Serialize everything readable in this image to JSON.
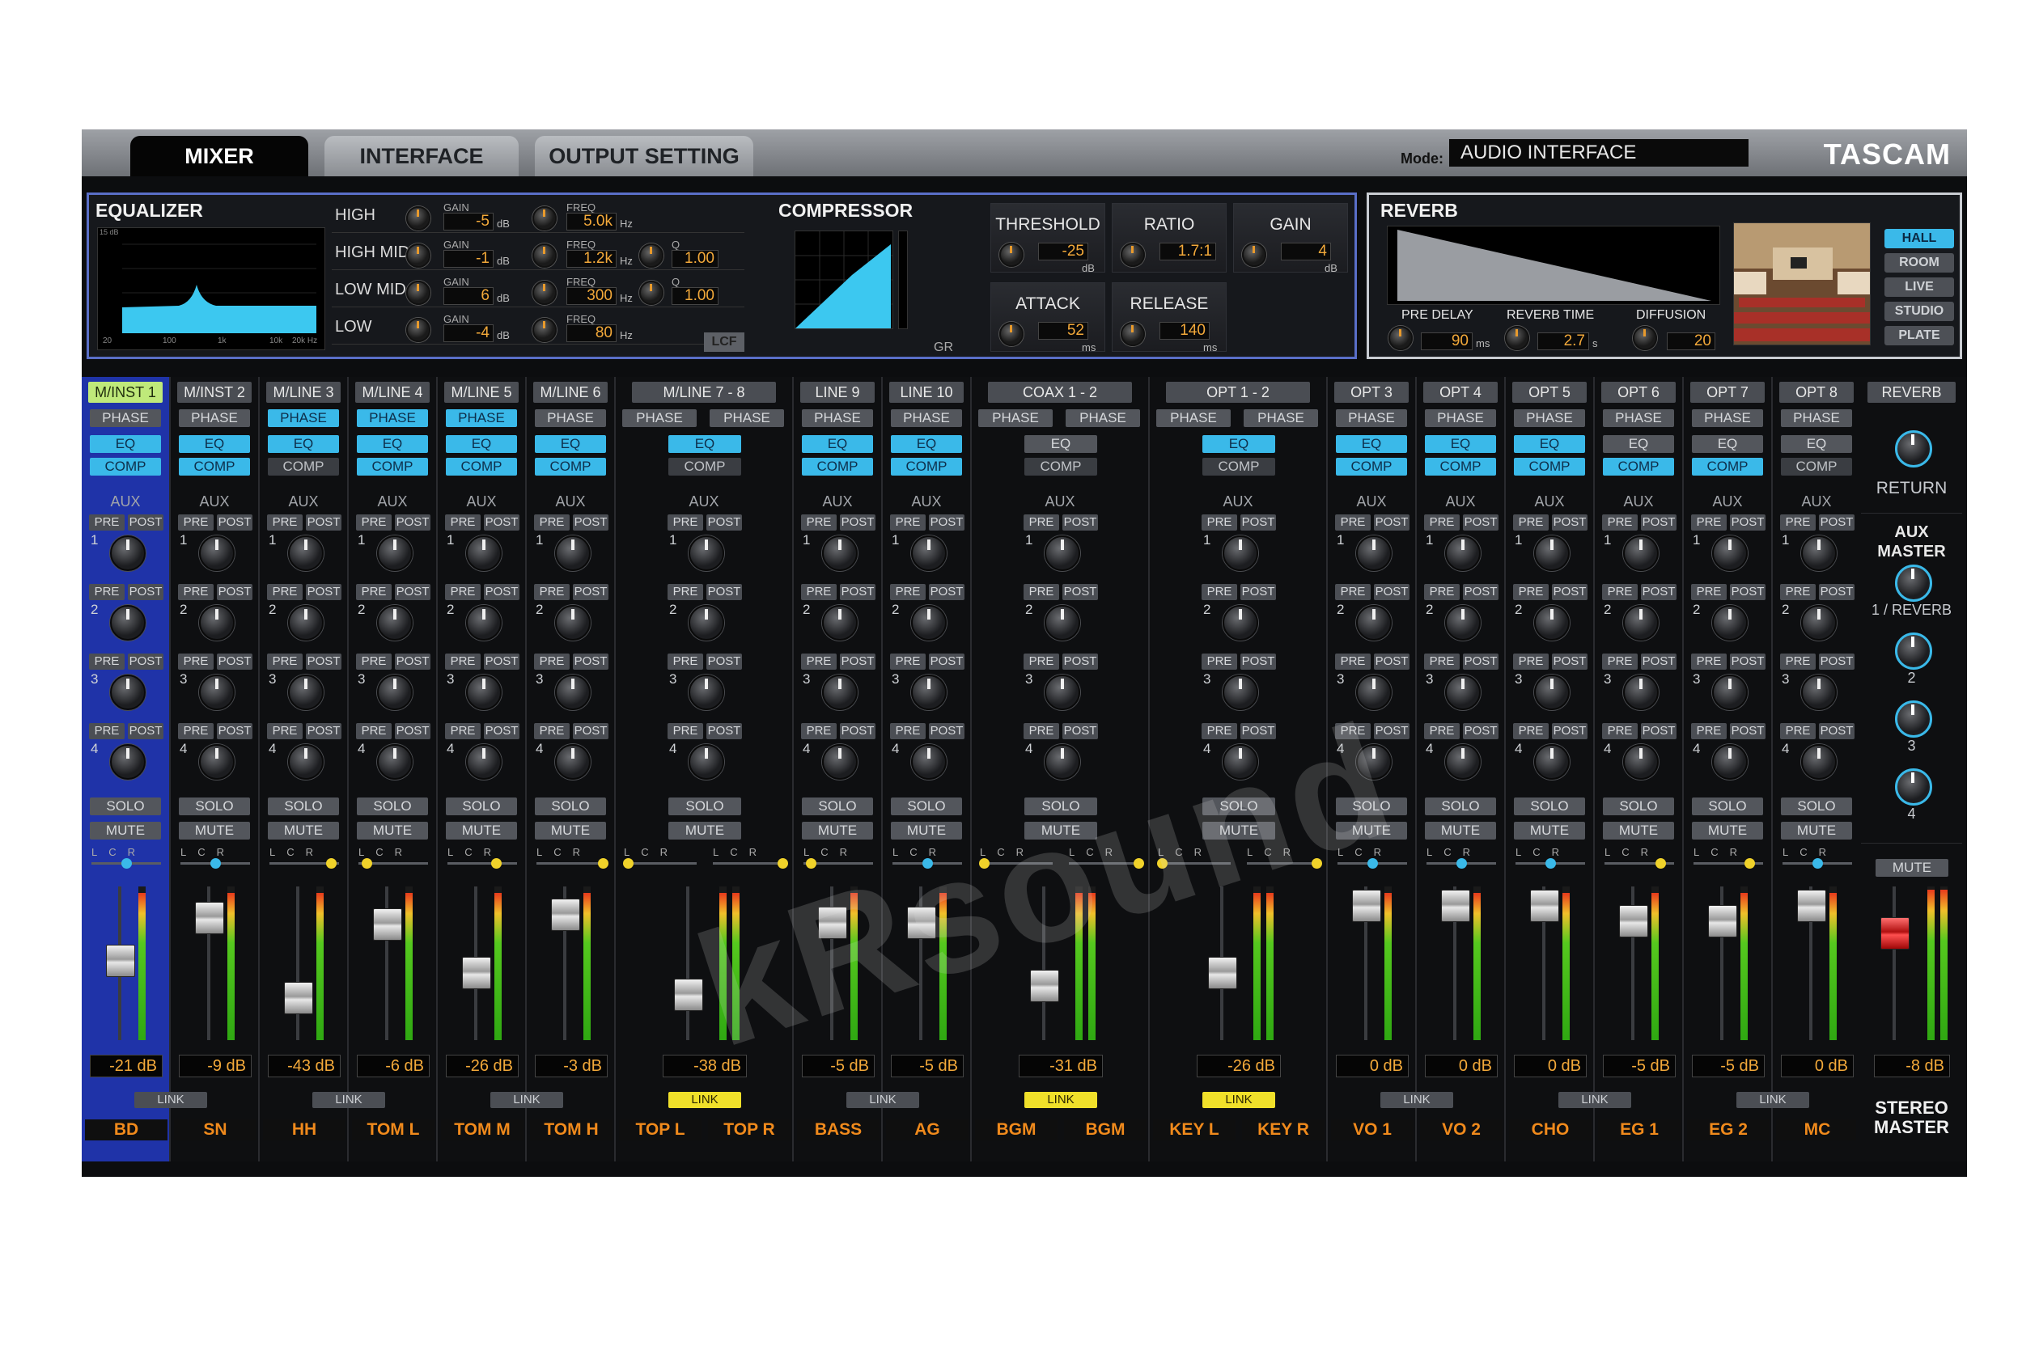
{
  "tabs": [
    {
      "label": "MIXER",
      "active": true
    },
    {
      "label": "INTERFACE",
      "active": false
    },
    {
      "label": "OUTPUT SETTING",
      "active": false
    }
  ],
  "mode": {
    "label": "Mode:",
    "value": "AUDIO INTERFACE"
  },
  "brand": "TASCAM",
  "equalizer": {
    "title": "EQUALIZER",
    "axis_y": [
      "15 dB",
      "10",
      "5",
      "0",
      "-5",
      "-10",
      "-15"
    ],
    "axis_x": [
      "20",
      "100",
      "1k",
      "10k",
      "20k Hz"
    ],
    "gain_label": "GAIN",
    "freq_label": "FREQ",
    "q_label": "Q",
    "db_unit": "dB",
    "hz_unit": "Hz",
    "bands": [
      {
        "name": "HIGH",
        "gain": "-5",
        "freq": "5.0k",
        "q": ""
      },
      {
        "name": "HIGH MID",
        "gain": "-1",
        "freq": "1.2k",
        "q": "1.00"
      },
      {
        "name": "LOW MID",
        "gain": "6",
        "freq": "300",
        "q": "1.00"
      },
      {
        "name": "LOW",
        "gain": "-4",
        "freq": "80",
        "q": ""
      }
    ],
    "lcf_label": "LCF"
  },
  "compressor": {
    "title": "COMPRESSOR",
    "axis_y": [
      "0",
      "-12",
      "-24",
      "-36",
      "-48"
    ],
    "axis_x": [
      "-48",
      "-36",
      "-24",
      "-12",
      "dB"
    ],
    "gr_label": "GR",
    "threshold": {
      "label": "THRESHOLD",
      "value": "-25",
      "unit": "dB"
    },
    "ratio": {
      "label": "RATIO",
      "value": "1.7:1"
    },
    "gain": {
      "label": "GAIN",
      "value": "4",
      "unit": "dB"
    },
    "attack": {
      "label": "ATTACK",
      "value": "52",
      "unit": "ms"
    },
    "release": {
      "label": "RELEASE",
      "value": "140",
      "unit": "ms"
    }
  },
  "reverb": {
    "title": "REVERB",
    "pre_delay": {
      "label": "PRE DELAY",
      "value": "90",
      "unit": "ms"
    },
    "reverb_time": {
      "label": "REVERB TIME",
      "value": "2.7",
      "unit": "s"
    },
    "diffusion": {
      "label": "DIFFUSION",
      "value": "20"
    },
    "types": [
      {
        "label": "HALL",
        "active": true
      },
      {
        "label": "ROOM",
        "active": false
      },
      {
        "label": "LIVE",
        "active": false
      },
      {
        "label": "STUDIO",
        "active": false
      },
      {
        "label": "PLATE",
        "active": false
      }
    ]
  },
  "strip_labels": {
    "phase": "PHASE",
    "eq": "EQ",
    "comp": "COMP",
    "aux": "AUX",
    "pre": "PRE",
    "post": "POST",
    "solo": "SOLO",
    "mute": "MUTE",
    "link": "LINK",
    "lcr": "LCR"
  },
  "aux_numbers": [
    "1",
    "2",
    "3",
    "4"
  ],
  "groups": [
    {
      "name": "M/INST 1",
      "highlight": true,
      "selected": true,
      "stereo": false,
      "phase": [
        false
      ],
      "eq": true,
      "comp": true,
      "pan": [
        0.5
      ],
      "fader": 0.52,
      "meters": [
        0.96
      ],
      "gain": "-21 dB",
      "link": false,
      "labels": [
        "BD"
      ]
    },
    {
      "name": "M/INST 2",
      "highlight": false,
      "selected": false,
      "stereo": false,
      "phase": [
        false
      ],
      "eq": true,
      "comp": true,
      "pan": [
        0.5
      ],
      "fader": 0.8,
      "meters": [
        0.96
      ],
      "gain": "-9 dB",
      "link": false,
      "labels": [
        "SN"
      ]
    },
    {
      "name": "M/LINE 3",
      "highlight": false,
      "selected": false,
      "stereo": false,
      "phase": [
        true
      ],
      "eq": true,
      "comp": false,
      "pan": [
        0.88
      ],
      "fader": 0.28,
      "meters": [
        0.96
      ],
      "gain": "-43 dB",
      "link": false,
      "labels": [
        "HH"
      ]
    },
    {
      "name": "M/LINE 4",
      "highlight": false,
      "selected": false,
      "stereo": false,
      "phase": [
        true
      ],
      "eq": true,
      "comp": true,
      "pan": [
        0.12
      ],
      "fader": 0.76,
      "meters": [
        0.96
      ],
      "gain": "-6 dB",
      "link": false,
      "labels": [
        "TOM L"
      ]
    },
    {
      "name": "M/LINE 5",
      "highlight": false,
      "selected": false,
      "stereo": false,
      "phase": [
        true
      ],
      "eq": true,
      "comp": true,
      "pan": [
        0.7
      ],
      "fader": 0.44,
      "meters": [
        0.96
      ],
      "gain": "-26 dB",
      "link": false,
      "labels": [
        "TOM M"
      ]
    },
    {
      "name": "M/LINE 6",
      "highlight": false,
      "selected": false,
      "stereo": false,
      "phase": [
        false
      ],
      "eq": true,
      "comp": true,
      "pan": [
        0.95
      ],
      "fader": 0.82,
      "meters": [
        0.96
      ],
      "gain": "-3 dB",
      "link": false,
      "labels": [
        "TOM H"
      ]
    },
    {
      "name": "M/LINE 7 - 8",
      "highlight": false,
      "selected": false,
      "stereo": true,
      "phase": [
        false,
        false
      ],
      "eq": true,
      "comp": false,
      "pan": [
        0.05,
        0.95
      ],
      "fader": 0.3,
      "meters": [
        0.96,
        0.96
      ],
      "gain": "-38 dB",
      "link": true,
      "labels": [
        "TOP L",
        "TOP R"
      ]
    },
    {
      "name": "LINE 9",
      "highlight": false,
      "selected": false,
      "stereo": false,
      "phase": [
        false
      ],
      "eq": true,
      "comp": true,
      "pan": [
        0.1
      ],
      "fader": 0.77,
      "meters": [
        0.96
      ],
      "gain": "-5 dB",
      "link": false,
      "labels": [
        "BASS"
      ]
    },
    {
      "name": "LINE 10",
      "highlight": false,
      "selected": false,
      "stereo": false,
      "phase": [
        false
      ],
      "eq": true,
      "comp": true,
      "pan": [
        0.5
      ],
      "fader": 0.77,
      "meters": [
        0.96
      ],
      "gain": "-5 dB",
      "link": false,
      "labels": [
        "AG"
      ]
    },
    {
      "name": "COAX 1 - 2",
      "highlight": false,
      "selected": false,
      "stereo": true,
      "phase": [
        false,
        false
      ],
      "eq": false,
      "comp": false,
      "pan": [
        0.05,
        0.95
      ],
      "fader": 0.36,
      "meters": [
        0.96,
        0.96
      ],
      "gain": "-31 dB",
      "link": true,
      "labels": [
        "BGM",
        "BGM"
      ]
    },
    {
      "name": "OPT 1 - 2",
      "highlight": false,
      "selected": false,
      "stereo": true,
      "phase": [
        false,
        false
      ],
      "eq": true,
      "comp": false,
      "pan": [
        0.05,
        0.95
      ],
      "fader": 0.44,
      "meters": [
        0.96,
        0.96
      ],
      "gain": "-26 dB",
      "link": true,
      "labels": [
        "KEY L",
        "KEY R"
      ]
    },
    {
      "name": "OPT 3",
      "highlight": false,
      "selected": false,
      "stereo": false,
      "phase": [
        false
      ],
      "eq": true,
      "comp": true,
      "pan": [
        0.5
      ],
      "fader": 0.88,
      "meters": [
        0.96
      ],
      "gain": "0 dB",
      "link": false,
      "labels": [
        "VO 1"
      ]
    },
    {
      "name": "OPT 4",
      "highlight": false,
      "selected": false,
      "stereo": false,
      "phase": [
        false
      ],
      "eq": true,
      "comp": true,
      "pan": [
        0.5
      ],
      "fader": 0.88,
      "meters": [
        0.96
      ],
      "gain": "0 dB",
      "link": false,
      "labels": [
        "VO 2"
      ]
    },
    {
      "name": "OPT 5",
      "highlight": false,
      "selected": false,
      "stereo": false,
      "phase": [
        false
      ],
      "eq": true,
      "comp": true,
      "pan": [
        0.5
      ],
      "fader": 0.88,
      "meters": [
        0.96
      ],
      "gain": "0 dB",
      "link": false,
      "labels": [
        "CHO"
      ]
    },
    {
      "name": "OPT 6",
      "highlight": false,
      "selected": false,
      "stereo": false,
      "phase": [
        false
      ],
      "eq": false,
      "comp": true,
      "pan": [
        0.8
      ],
      "fader": 0.78,
      "meters": [
        0.96
      ],
      "gain": "-5 dB",
      "link": false,
      "labels": [
        "EG 1"
      ]
    },
    {
      "name": "OPT 7",
      "highlight": false,
      "selected": false,
      "stereo": false,
      "phase": [
        false
      ],
      "eq": false,
      "comp": true,
      "pan": [
        0.8
      ],
      "fader": 0.78,
      "meters": [
        0.96
      ],
      "gain": "-5 dB",
      "link": false,
      "labels": [
        "EG 2"
      ]
    },
    {
      "name": "OPT 8",
      "highlight": false,
      "selected": false,
      "stereo": false,
      "phase": [
        false
      ],
      "eq": false,
      "comp": false,
      "pan": [
        0.5
      ],
      "fader": 0.88,
      "meters": [
        0.96
      ],
      "gain": "0 dB",
      "link": false,
      "labels": [
        "MC"
      ]
    }
  ],
  "master": {
    "reverb_button": "REVERB",
    "return_label": "RETURN",
    "aux_master_label": "AUX MASTER",
    "aux_knobs": [
      "1 / REVERB",
      "2",
      "3",
      "4"
    ],
    "mute_label": "MUTE",
    "fader": 0.7,
    "meters": [
      0.98,
      0.98
    ],
    "gain": "-8 dB",
    "stereo_master_label": "STEREO MASTER"
  },
  "watermark": "kRsound",
  "colors": {
    "accent_blue": "#3ab9e9",
    "selected_strip": "#1f33a8",
    "link_on": "#f0e02a",
    "value_orange": "#f3a93a",
    "label_orange": "#f08a1c",
    "pan_blue": "#3ab9e9",
    "pan_yellow": "#f0d22a"
  }
}
